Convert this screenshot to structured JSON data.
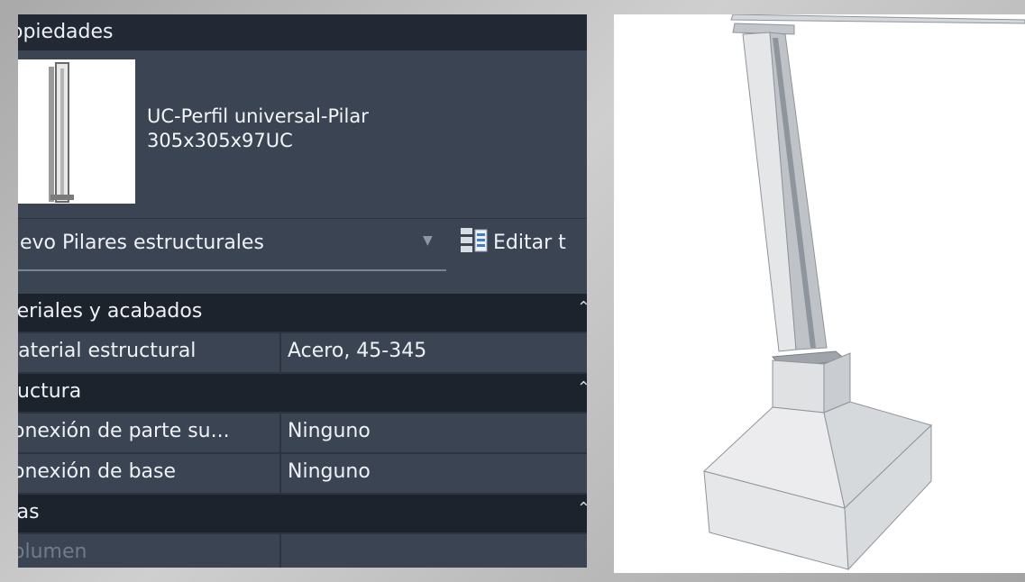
{
  "properties": {
    "header_title": "opiedades",
    "type_name_line1": "UC-Perfil universal-Pilar",
    "type_name_line2": "305x305x97UC",
    "selector_value": "uevo Pilares estructurales",
    "edit_type_label": "Editar t",
    "groups": [
      {
        "label": "teriales y acabados",
        "rows": [
          {
            "name": "laterial estructural",
            "value": "Acero, 45-345"
          }
        ]
      },
      {
        "label": "ructura",
        "rows": [
          {
            "name": "onexión de parte su...",
            "value": "Ninguno"
          },
          {
            "name": "onexión de base",
            "value": "Ninguno"
          }
        ]
      },
      {
        "label": "tas",
        "rows": [
          {
            "name": "olumen",
            "value": ""
          }
        ]
      }
    ],
    "icons": {
      "collapse": "chevron-up-double-icon",
      "dropdown": "chevron-down-icon",
      "edit_type": "edit-type-icon"
    }
  },
  "colors": {
    "panel_bg": "#3b4453",
    "header_bg": "#222834",
    "group_bg": "#1d232d",
    "text": "#eef1f5",
    "viewport_bg": "#ffffff"
  }
}
